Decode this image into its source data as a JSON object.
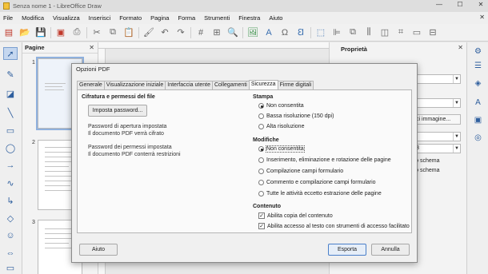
{
  "window": {
    "title": "Senza nome 1 - LibreOffice Draw"
  },
  "menu": [
    "File",
    "Modifica",
    "Visualizza",
    "Inserisci",
    "Formato",
    "Pagina",
    "Forma",
    "Strumenti",
    "Finestra",
    "Aiuto"
  ],
  "pages_panel": {
    "title": "Pagine",
    "page_numbers": [
      "1",
      "2",
      "3"
    ]
  },
  "sidebar": {
    "title": "Proprietà",
    "button_label": "ci immagine...",
    "field_value": "3",
    "text_lines": [
      "llo schema",
      "llo schema"
    ]
  },
  "dialog": {
    "title": "Opzioni PDF",
    "tabs": [
      "Generale",
      "Visualizzazione iniziale",
      "Interfaccia utente",
      "Collegamenti",
      "Sicurezza",
      "Firme digitali"
    ],
    "active_tab": "Sicurezza",
    "encryption": {
      "heading": "Cifratura e permessi del file",
      "set_password_button": "Imposta password...",
      "open_password_line1": "Password di apertura impostata",
      "open_password_line2": "Il documento PDF verrà cifrato",
      "perm_password_line1": "Password dei permessi impostata",
      "perm_password_line2": "Il documento PDF conterrà restrizioni"
    },
    "printing": {
      "heading": "Stampa",
      "options": [
        "Non consentita",
        "Bassa risoluzione (150 dpi)",
        "Alta risoluzione"
      ],
      "selected": 0
    },
    "changes": {
      "heading": "Modifiche",
      "options": [
        "Non consentita",
        "Inserimento, eliminazione e rotazione delle pagine",
        "Compilazione campi formulario",
        "Commento e compilazione campi formulario",
        "Tutte le attività eccetto estrazione delle pagine"
      ],
      "selected": 0
    },
    "content": {
      "heading": "Contenuto",
      "options": [
        "Abilita copia del contenuto",
        "Abilita accesso al testo con strumenti di accesso facilitato"
      ],
      "checked": [
        true,
        true
      ]
    },
    "buttons": {
      "help": "Aiuto",
      "export": "Esporta",
      "cancel": "Annulla"
    }
  }
}
